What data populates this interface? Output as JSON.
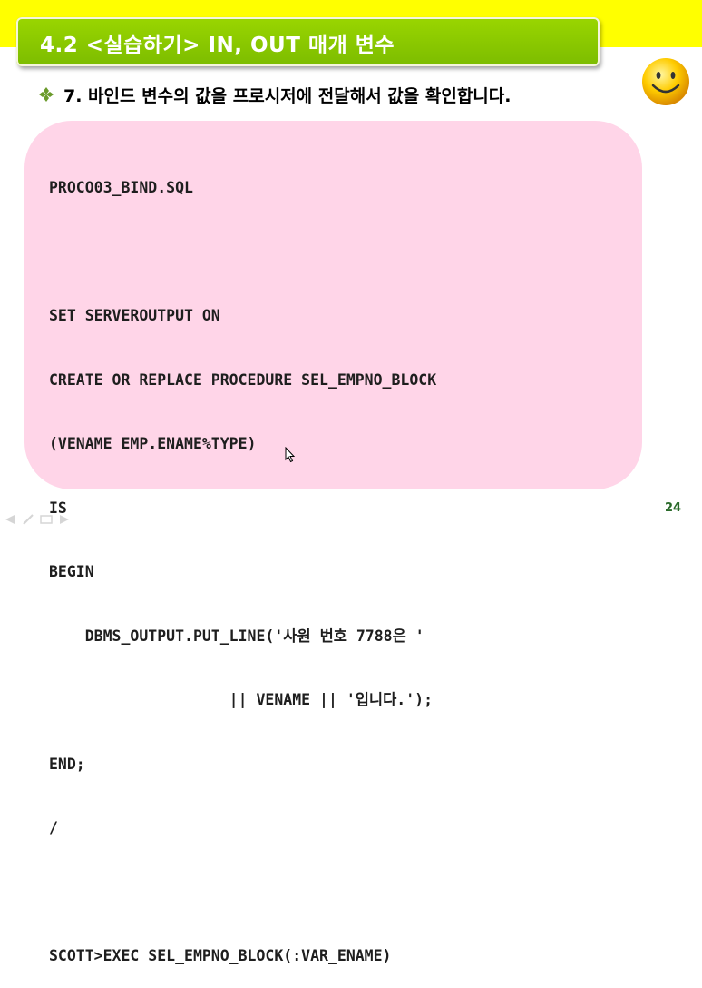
{
  "slide": {
    "title": "4.2 <실습하기> IN, OUT 매개 변수",
    "subtitle": "7. 바인드 변수의 값을 프로시저에 전달해서 값을 확인합니다.",
    "page_number": "24"
  },
  "code": {
    "lines": [
      "PROCO03_BIND.SQL",
      "",
      "SET SERVEROUTPUT ON",
      "CREATE OR REPLACE PROCEDURE SEL_EMPNO_BLOCK",
      "(VENAME EMP.ENAME%TYPE)",
      "IS",
      "BEGIN",
      "    DBMS_OUTPUT.PUT_LINE('사원 번호 7788은 '",
      "                    || VENAME || '입니다.');",
      "END;",
      "/",
      "",
      "SCOTT>EXEC SEL_EMPNO_BLOCK(:VAR_ENAME)"
    ]
  },
  "colors": {
    "top_band": "#ffff00",
    "title_bar": "#8cc800",
    "code_panel": "#ffd5e8",
    "page_number": "#2a6a2a"
  },
  "icons": {
    "bullet": "diamond-bullet-icon",
    "decoration": "smiley-face-icon",
    "pointer": "mouse-cursor-icon"
  }
}
